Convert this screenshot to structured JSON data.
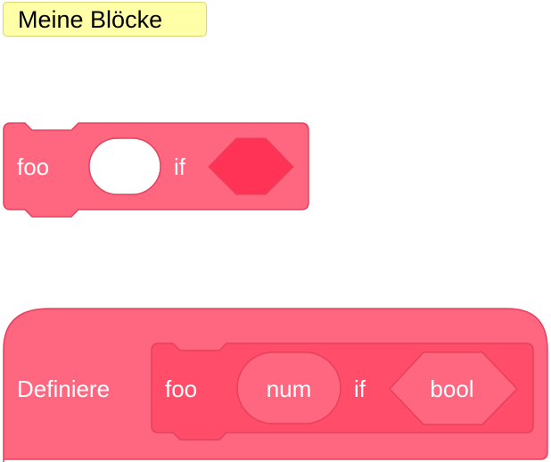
{
  "palette": {
    "category_label": "Meine Blöcke"
  },
  "colors": {
    "block_primary": "#ff6680",
    "block_secondary": "#ff4d6a",
    "block_border": "#e6405c",
    "boolean_input": "#ff3355",
    "category_bg": "#ffffa8",
    "white": "#ffffff"
  },
  "call_block": {
    "label": "foo",
    "keyword": "if",
    "inputs": [
      "number-input",
      "boolean-input"
    ]
  },
  "define_block": {
    "label": "Definiere",
    "prototype": {
      "label": "foo",
      "keyword": "if",
      "number_arg": "num",
      "boolean_arg": "bool"
    }
  }
}
